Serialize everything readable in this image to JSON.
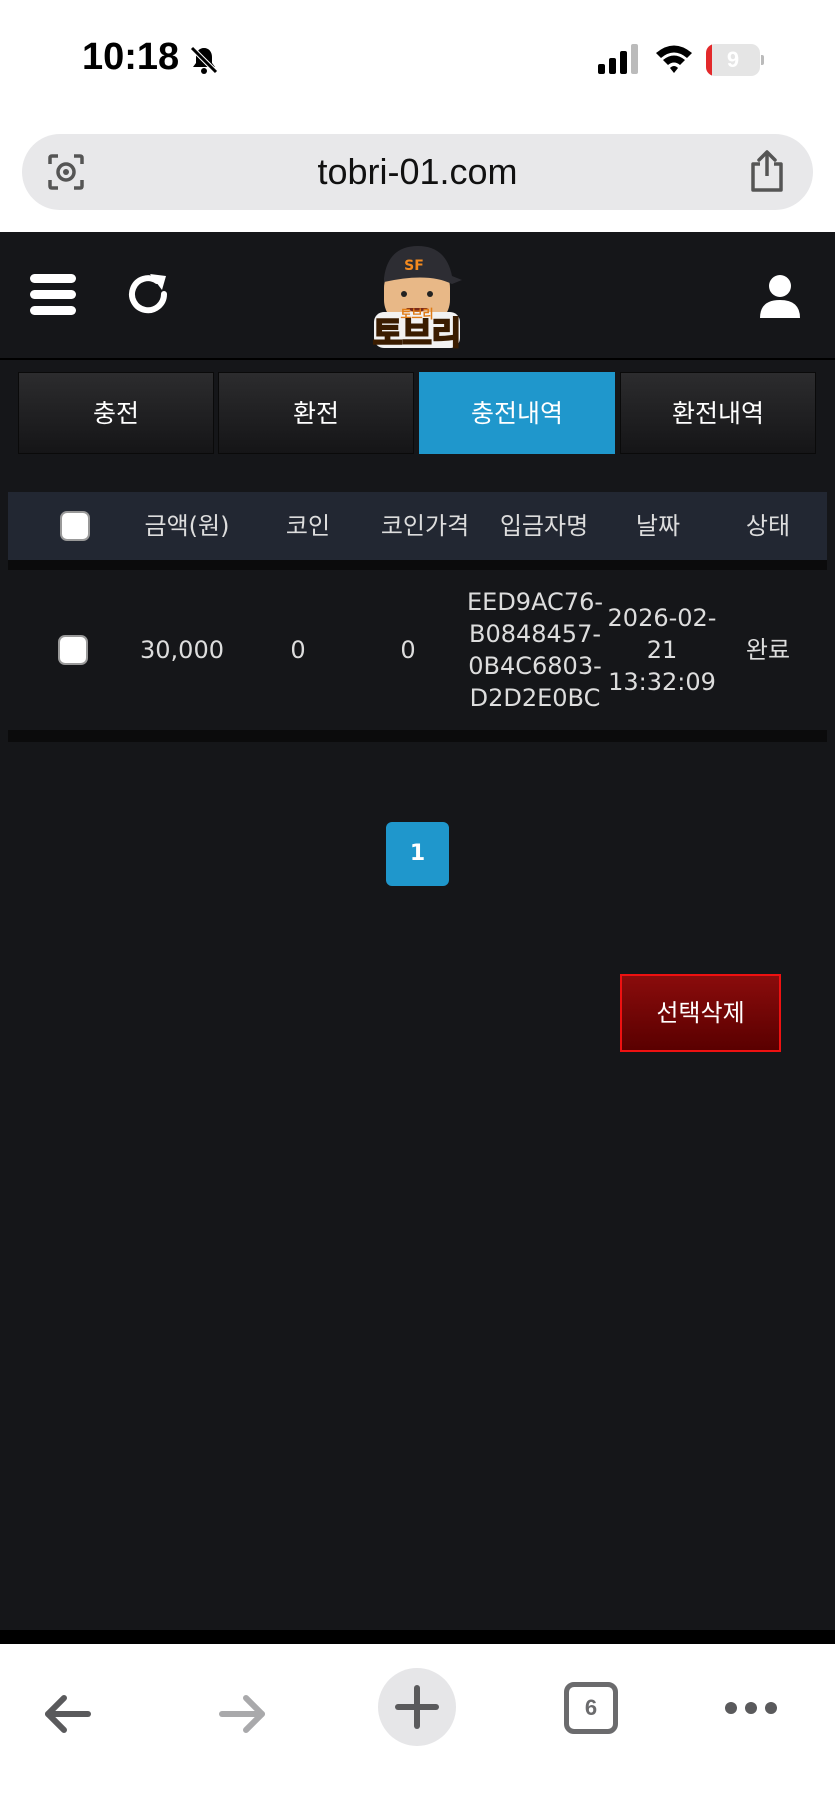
{
  "status_bar": {
    "time": "10:18",
    "battery": "9"
  },
  "browser": {
    "url": "tobri-01.com",
    "open_tabs": "6"
  },
  "header": {
    "logo_text": "토브리"
  },
  "tabs": [
    {
      "label": "충전",
      "active": false
    },
    {
      "label": "환전",
      "active": false
    },
    {
      "label": "충전내역",
      "active": true
    },
    {
      "label": "환전내역",
      "active": false
    }
  ],
  "table": {
    "headers": [
      "금액(원)",
      "코인",
      "코인가격",
      "입금자명",
      "날짜",
      "상태"
    ],
    "rows": [
      {
        "amount": "30,000",
        "coin": "0",
        "coin_price": "0",
        "depositor_lines": [
          "EED9AC76-",
          "B0848457-",
          "0B4C6803-",
          "D2D2E0BC"
        ],
        "date_lines": [
          "2026-02-",
          "21",
          "13:32:09"
        ],
        "status": "완료"
      }
    ]
  },
  "pagination": {
    "current": "1"
  },
  "actions": {
    "delete_selected": "선택삭제"
  },
  "colors": {
    "accent": "#1f97cc",
    "background": "#151619",
    "danger": "#8a0c0c"
  }
}
